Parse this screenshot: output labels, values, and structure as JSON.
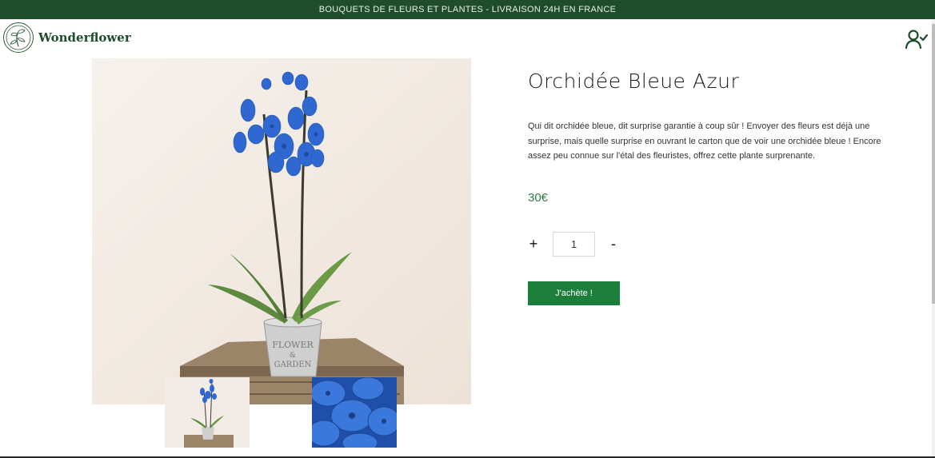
{
  "announcement": "BOUQUETS DE FLEURS ET PLANTES - LIVRAISON 24H EN FRANCE",
  "brand": {
    "name": "Wonderflower"
  },
  "header": {
    "account_icon": "user-check-icon",
    "logo_icon": "flower-wreath-icon"
  },
  "product": {
    "title": "Orchidée Bleue Azur",
    "description": "Qui dit orchidée bleue, dit surprise garantie à coup sûr ! Envoyer des fleurs est déjà une surprise, mais quelle surprise en ouvrant le carton que de voir une orchidée bleue ! Encore assez peu connue sur l'étal des fleuristes, offrez cette plante surprenante.",
    "price": "30€",
    "pot_text": {
      "line1": "FLOWER",
      "line2": "&",
      "line3": "GARDEN"
    }
  },
  "quantity": {
    "plus": "+",
    "value": "1",
    "minus": "-"
  },
  "buy_button": "J'achète !",
  "colors": {
    "brand_green": "#1f4d2b",
    "button_green": "#1b7e3b",
    "price_green": "#2f7d46",
    "orchid_blue": "#2f68d0"
  }
}
